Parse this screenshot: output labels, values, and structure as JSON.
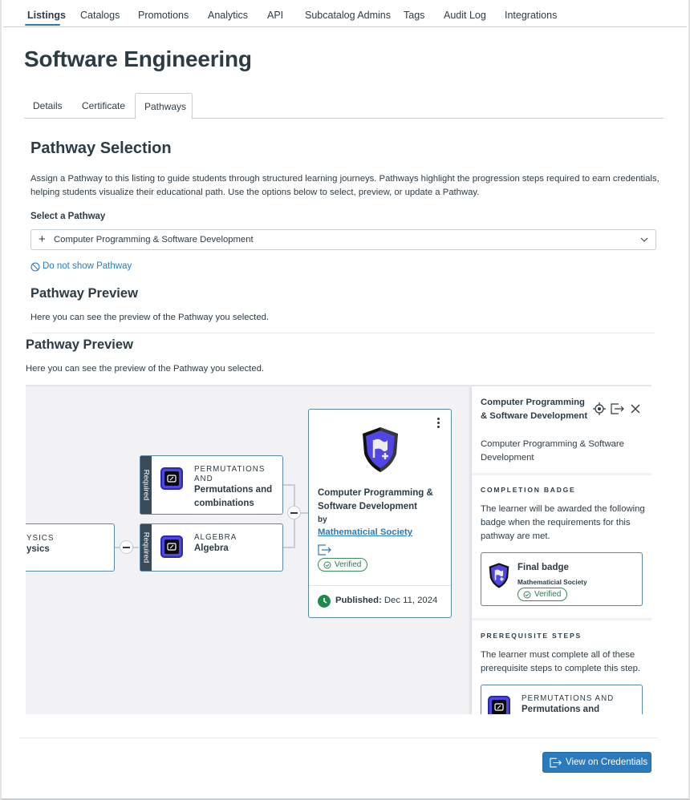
{
  "top_nav": {
    "items": [
      {
        "label": "Listings",
        "active": true
      },
      {
        "label": "Catalogs"
      },
      {
        "label": "Promotions"
      },
      {
        "label": "Analytics"
      },
      {
        "label": "API"
      },
      {
        "label": "Subcatalog Admins"
      },
      {
        "label": "Tags"
      },
      {
        "label": "Audit Log"
      },
      {
        "label": "Integrations"
      }
    ]
  },
  "page_title": "Software Engineering",
  "sub_tabs": [
    {
      "label": "Details"
    },
    {
      "label": "Certificate"
    },
    {
      "label": "Pathways",
      "active": true
    }
  ],
  "pathway_selection": {
    "heading": "Pathway Selection",
    "description_line1": "Assign a Pathway to this listing to guide students through structured learning journeys. Pathways highlight the progression steps required to earn credentials,",
    "description_line2": "helping students visualize their educational path. Use the options below to select, preview, or update a Pathway.",
    "select_label": "Select a Pathway",
    "selected_value": "Computer Programming & Software Development",
    "do_not_show_label": "Do not show Pathway"
  },
  "preview_1": {
    "heading": "Pathway Preview",
    "description": "Here you can see the preview of the Pathway you selected."
  },
  "preview_2": {
    "heading": "Pathway Preview",
    "description": "Here you can see the preview of the Pathway you selected."
  },
  "canvas": {
    "left_node": {
      "kind": "YSICS",
      "name": "ysics"
    },
    "required_label": "Required",
    "step_nodes": [
      {
        "kind_line1": "PERMUTATIONS",
        "kind_line2": "AND",
        "name_line1": "Permutations and",
        "name_line2": "combinations"
      },
      {
        "kind_line1": "ALGEBRA",
        "name_line1": "Algebra"
      }
    ],
    "main_card": {
      "title": "Computer Programming & Software Development",
      "by": "by",
      "organization": "Mathematicial Society",
      "verified": "Verified",
      "published_label": "Published:",
      "published_date": "Dec 11, 2024"
    }
  },
  "side_panel": {
    "title": "Computer Programming & Software Development",
    "description": "Computer Programming & Software Development",
    "completion_badge": {
      "heading": "COMPLETION BADGE",
      "text": "The learner will be awarded the following badge when the requirements for this pathway are met.",
      "badge_name": "Final badge",
      "badge_org": "Mathematicial Society",
      "verified": "Verified"
    },
    "prerequisite_steps": {
      "heading": "PREREQUISITE STEPS",
      "text": "The learner must complete all of these prerequisite steps to complete this step.",
      "step_kind": "PERMUTATIONS AND",
      "step_name": "Permutations and"
    }
  },
  "footer": {
    "view_button": "View on Credentials"
  },
  "colors": {
    "accent": "#2b7abc",
    "verified_green": "#2a7d4f",
    "required_strip": "#394b58",
    "badge_purple": "#4f46e5"
  }
}
